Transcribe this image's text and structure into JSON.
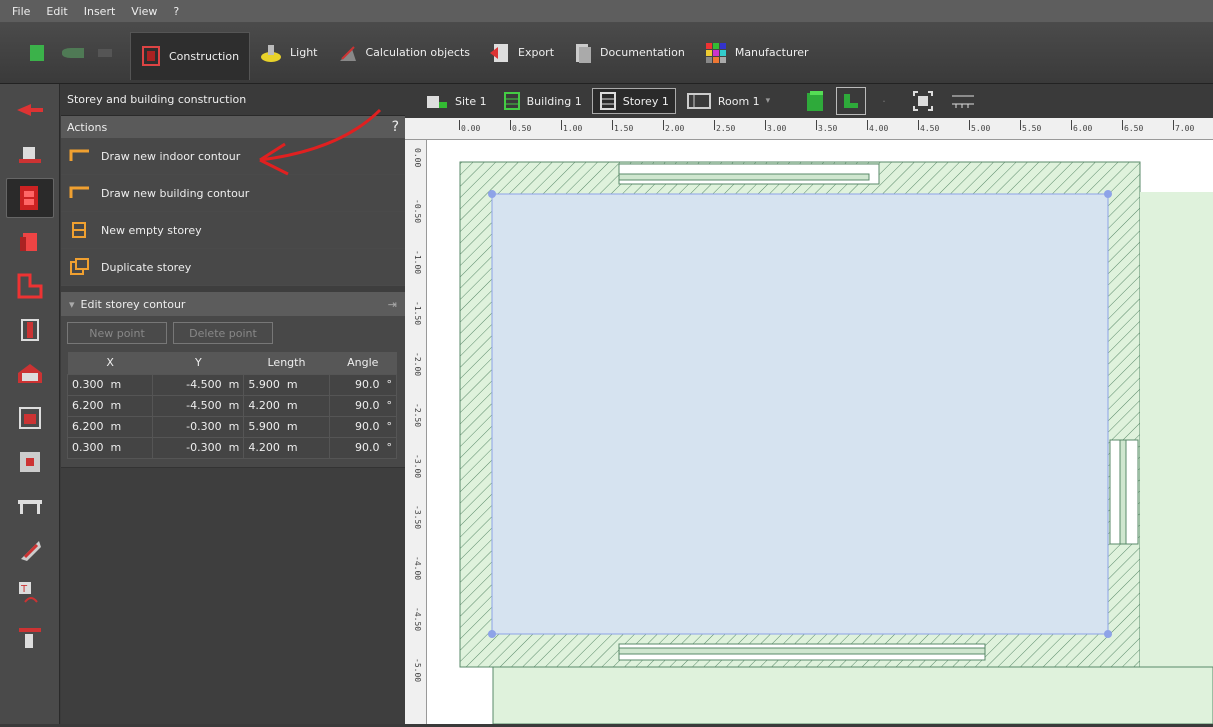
{
  "menu": [
    "File",
    "Edit",
    "Insert",
    "View",
    "?"
  ],
  "toolbar": {
    "tabs": [
      {
        "label": "Construction",
        "active": true
      },
      {
        "label": "Light"
      },
      {
        "label": "Calculation objects"
      },
      {
        "label": "Export"
      },
      {
        "label": "Documentation"
      },
      {
        "label": "Manufacturer"
      }
    ]
  },
  "panel": {
    "title": "Storey and building construction",
    "actions_header": "Actions",
    "actions_help": "?",
    "actions": [
      {
        "label": "Draw new indoor contour"
      },
      {
        "label": "Draw new building contour"
      },
      {
        "label": "New empty storey"
      },
      {
        "label": "Duplicate storey"
      }
    ],
    "edit_header": "Edit storey contour",
    "new_point": "New point",
    "delete_point": "Delete point",
    "columns": [
      "X",
      "Y",
      "Length",
      "Angle"
    ],
    "rows": [
      {
        "x": "0.300",
        "xu": "m",
        "y": "-4.500",
        "yu": "m",
        "len": "5.900",
        "lu": "m",
        "ang": "90.0",
        "au": "°"
      },
      {
        "x": "6.200",
        "xu": "m",
        "y": "-4.500",
        "yu": "m",
        "len": "4.200",
        "lu": "m",
        "ang": "90.0",
        "au": "°"
      },
      {
        "x": "6.200",
        "xu": "m",
        "y": "-0.300",
        "yu": "m",
        "len": "5.900",
        "lu": "m",
        "ang": "90.0",
        "au": "°"
      },
      {
        "x": "0.300",
        "xu": "m",
        "y": "-0.300",
        "yu": "m",
        "len": "4.200",
        "lu": "m",
        "ang": "90.0",
        "au": "°"
      }
    ]
  },
  "canvas_bar": {
    "site": "Site 1",
    "building": "Building 1",
    "storey": "Storey 1",
    "room": "Room 1"
  },
  "ruler_top": [
    "0.00",
    "0.50",
    "1.00",
    "1.50",
    "2.00",
    "2.50",
    "3.00",
    "3.50",
    "4.00",
    "4.50",
    "5.00",
    "5.50",
    "6.00",
    "6.50",
    "7.00"
  ],
  "ruler_left": [
    "0.00",
    "-0.50",
    "-1.00",
    "-1.50",
    "-2.00",
    "-2.50",
    "-3.00",
    "-3.50",
    "-4.00",
    "-4.50",
    "-5.00"
  ],
  "colors": {
    "room_fill": "#d6e3f0",
    "room_stroke": "#8ea3e8",
    "outside": "#dff2dc",
    "hatch": "#5a8a6a",
    "annotation": "#e02020"
  }
}
